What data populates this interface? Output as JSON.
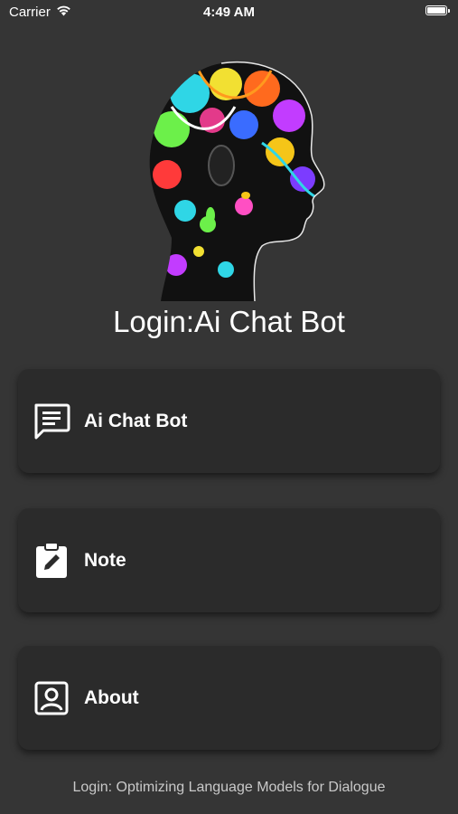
{
  "status_bar": {
    "carrier": "Carrier",
    "time": "4:49 AM",
    "wifi_icon": "wifi-icon",
    "battery_icon": "battery-icon",
    "battery_level": 1.0
  },
  "hero": {
    "image": "colorful-head-profile-illustration"
  },
  "title": "Login:Ai Chat Bot",
  "menu": [
    {
      "label": "Ai Chat Bot",
      "icon": "chat-icon"
    },
    {
      "label": "Note",
      "icon": "note-icon"
    },
    {
      "label": "About",
      "icon": "about-icon"
    }
  ],
  "footer": "Login: Optimizing Language Models for Dialogue",
  "colors": {
    "background": "#353535",
    "card": "#2b2b2b",
    "text": "#ffffff",
    "footer_text": "#c9c9c9"
  }
}
